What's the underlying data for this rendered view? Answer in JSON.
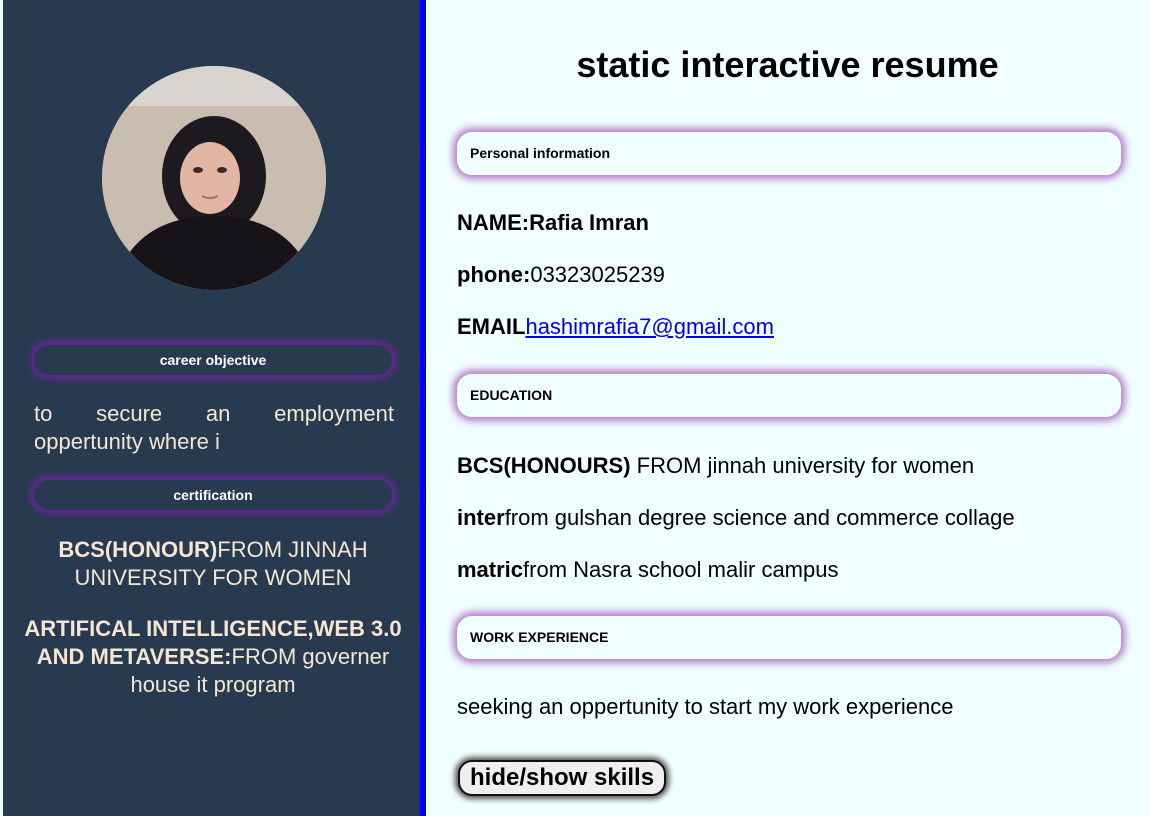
{
  "sidebar": {
    "career_objective_label": "career objective",
    "career_objective_text": "to secure an employment oppertunity where i",
    "certification_label": "certification",
    "cert1_bold": "BCS(HONOUR)",
    "cert1_rest": "FROM JINNAH UNIVERSITY FOR WOMEN",
    "cert2_bold": "ARTIFICAL INTELLIGENCE,WEB 3.0 AND METAVERSE:",
    "cert2_rest": "FROM governer house it program"
  },
  "main": {
    "title": "static interactive resume",
    "personal": {
      "header": "Personal information",
      "name_label": "NAME:",
      "name_value": "Rafia Imran",
      "phone_label": "phone:",
      "phone_value": "03323025239",
      "email_label": "EMAIL",
      "email_value": "hashimrafia7@gmail.com"
    },
    "education": {
      "header": "EDUCATION",
      "items": [
        {
          "bold": "BCS(HONOURS)",
          "rest": " FROM jinnah university for women"
        },
        {
          "bold": "inter",
          "rest": "from gulshan degree science and commerce collage"
        },
        {
          "bold": "matric",
          "rest": "from Nasra school malir campus"
        }
      ]
    },
    "work": {
      "header": "WORK EXPERIENCE",
      "text": "seeking an oppertunity to start my work experience"
    },
    "skills_button": "hide/show skills"
  }
}
